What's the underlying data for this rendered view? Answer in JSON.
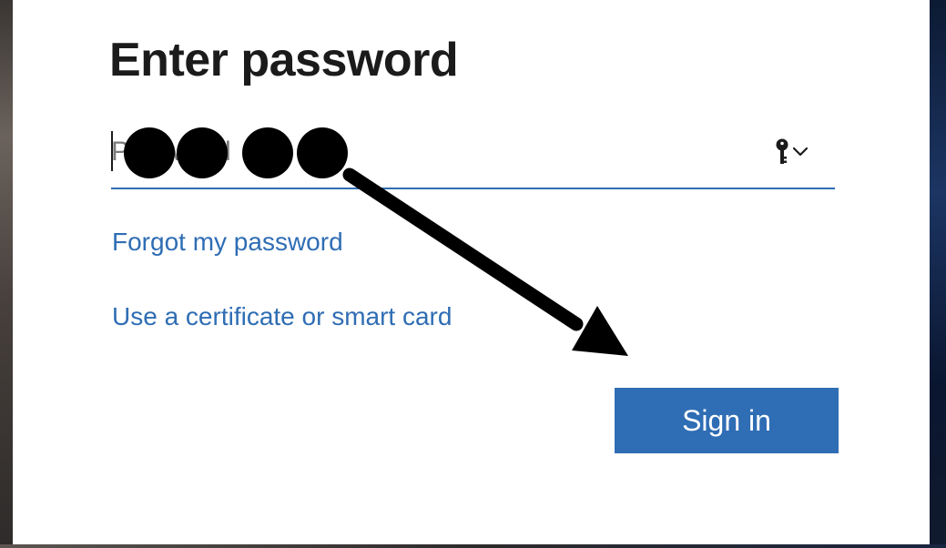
{
  "dialog": {
    "title": "Enter password",
    "password_field": {
      "placeholder": "Password",
      "value": "",
      "masked_dot_count": 4,
      "trailing_icon": "key-icon",
      "dropdown_icon": "chevron-down-icon"
    },
    "links": {
      "forgot_password": "Forgot my password",
      "certificate": "Use a certificate or smart card"
    },
    "primary_button": {
      "label": "Sign in"
    }
  },
  "annotation": {
    "icon": "arrow-annotation",
    "color": "#000000",
    "points_to": "Sign in"
  },
  "colors": {
    "accent": "#2f6db4",
    "title_text": "#1b1b1b",
    "background": "#ffffff",
    "redaction": "#000000"
  }
}
